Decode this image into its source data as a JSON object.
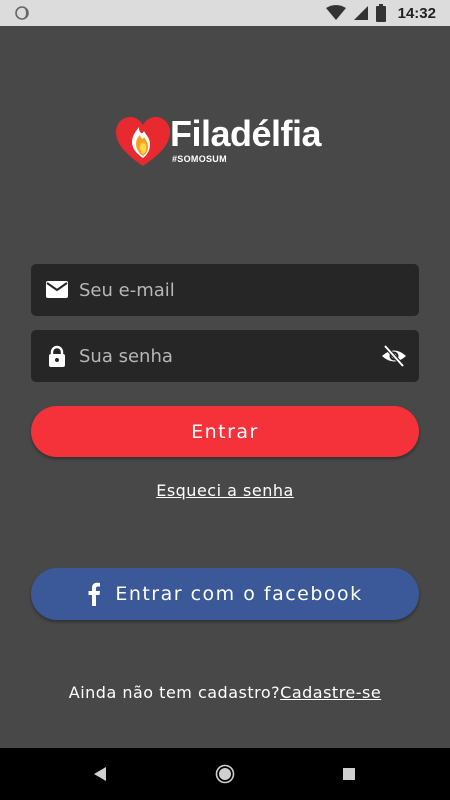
{
  "status_bar": {
    "time": "14:32",
    "icons": [
      "wifi-icon",
      "signal-icon",
      "battery-icon"
    ]
  },
  "brand": {
    "name": "Filadélfia",
    "tagline": "#SOMOSUM",
    "colors": {
      "heart": "#e8292f",
      "flame": "#f6a21c"
    }
  },
  "login_form": {
    "email_placeholder": "Seu e-mail",
    "password_placeholder": "Sua senha",
    "submit_label": "Entrar",
    "forgot_link": "Esqueci a senha"
  },
  "facebook": {
    "button_label": "Entrar com o facebook"
  },
  "signup": {
    "prompt": "Ainda não tem cadastro?",
    "link_label": "Cadastre-se"
  },
  "colors": {
    "background": "#484848",
    "field_background": "#262626",
    "primary_button": "#f5313a",
    "facebook_button": "#3b5998",
    "status_bar": "#dcdcdc",
    "nav_bar": "#000000"
  }
}
